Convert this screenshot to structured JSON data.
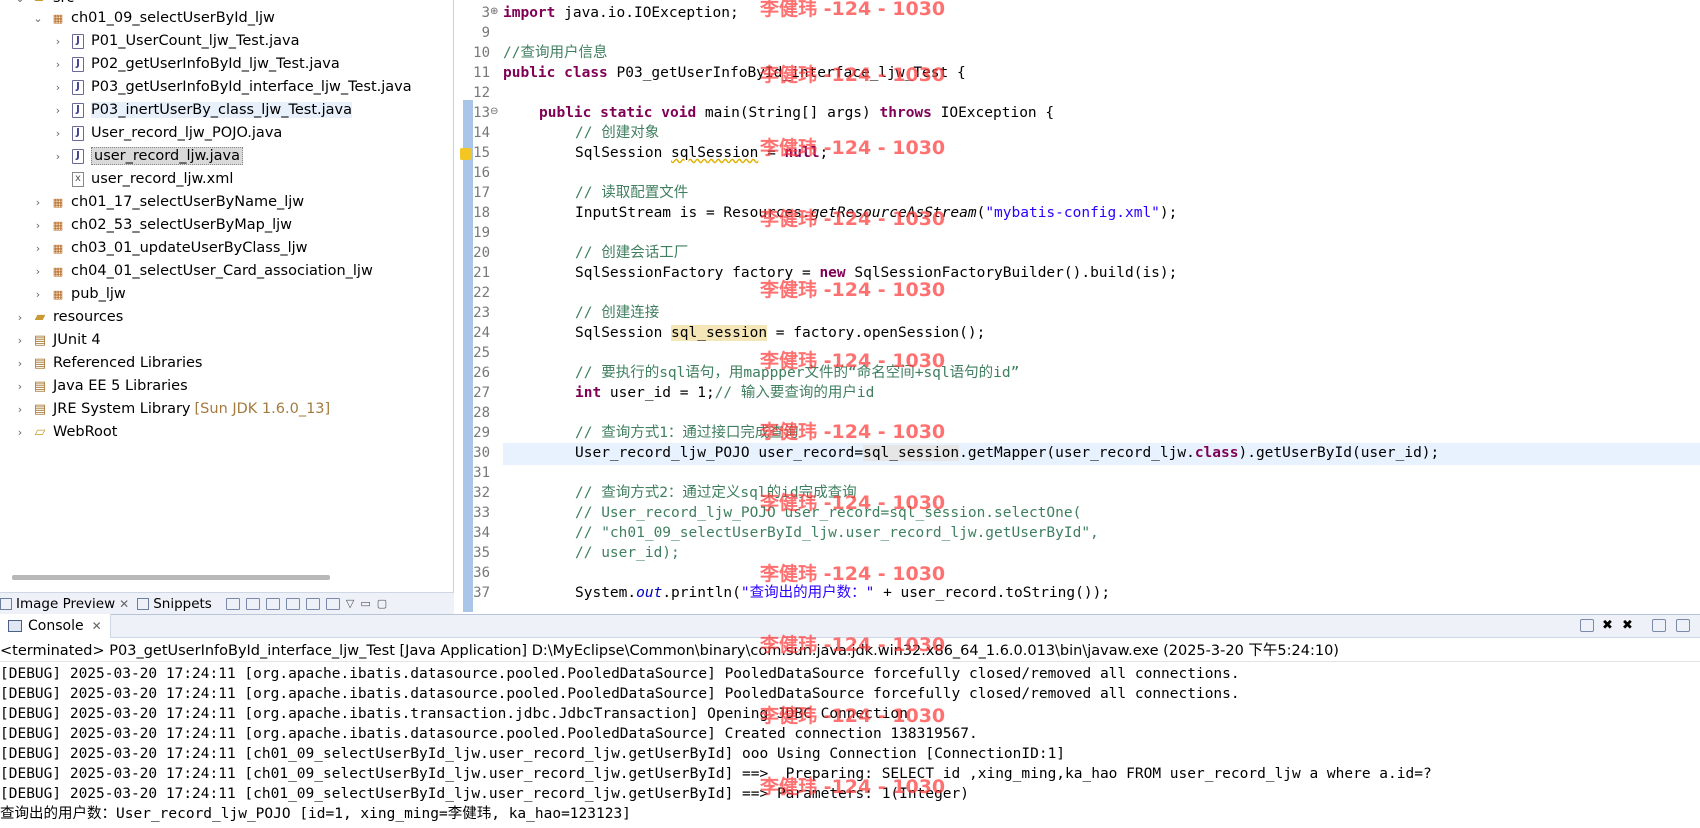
{
  "tree": {
    "items": [
      {
        "label": "src"
      },
      {
        "label": "ch01_09_selectUserById_ljw"
      },
      {
        "label": "P01_UserCount_ljw_Test.java"
      },
      {
        "label": "P02_getUserInfoById_ljw_Test.java"
      },
      {
        "label": "P03_getUserInfoById_interface_ljw_Test.java"
      },
      {
        "label": "P03_inertUserBy_class_ljw_Test.java"
      },
      {
        "label": "User_record_ljw_POJO.java"
      },
      {
        "label": "user_record_ljw.java"
      },
      {
        "label": "user_record_ljw.xml"
      },
      {
        "label": "ch01_17_selectUserByName_ljw"
      },
      {
        "label": "ch02_53_selectUserByMap_ljw"
      },
      {
        "label": "ch03_01_updateUserByClass_ljw"
      },
      {
        "label": "ch04_01_selectUser_Card_association_ljw"
      },
      {
        "label": "pub_ljw"
      },
      {
        "label": "resources"
      },
      {
        "label": "JUnit 4"
      },
      {
        "label": "Referenced Libraries"
      },
      {
        "label": "Java EE 5 Libraries"
      },
      {
        "label": "JRE System Library",
        "extra": "[Sun JDK 1.6.0_13]"
      },
      {
        "label": "WebRoot"
      }
    ]
  },
  "left_tabs": {
    "image_preview": "Image Preview",
    "snippets": "Snippets"
  },
  "editor": {
    "line_numbers": [
      "3",
      "9",
      "10",
      "11",
      "12",
      "13",
      "14",
      "15",
      "16",
      "17",
      "18",
      "19",
      "20",
      "21",
      "22",
      "23",
      "24",
      "25",
      "26",
      "27",
      "28",
      "29",
      "30",
      "31",
      "32",
      "33",
      "34",
      "35",
      "36",
      "37"
    ],
    "l3_kw": "import",
    "l3_rest": " java.io.IOException;",
    "l10": "//查询用户信息",
    "l11_kw1": "public",
    "l11_kw2": "class",
    "l11_rest": " P03_getUserInfoById_interface_ljw_Test {",
    "l13_kw1": "public",
    "l13_kw2": "static",
    "l13_kw3": "void",
    "l13_mid": " main(String[] args) ",
    "l13_kw4": "throws",
    "l13_rest": " IOException {",
    "l14": "// 创建对象",
    "l15_a": "SqlSession ",
    "l15_var": "sqlSession",
    "l15_b": " = ",
    "l15_kw": "null",
    "l15_c": ";",
    "l17": "// 读取配置文件",
    "l18_a": "InputStream is = Resources.",
    "l18_method": "getResourceAsStream",
    "l18_b": "(",
    "l18_str": "\"mybatis-config.xml\"",
    "l18_c": ");",
    "l20": "// 创建会话工厂",
    "l21_a": "SqlSessionFactory factory = ",
    "l21_kw": "new",
    "l21_b": " SqlSessionFactoryBuilder().build(is);",
    "l23": "// 创建连接",
    "l24_a": "SqlSession ",
    "l24_var": "sql_session",
    "l24_b": " = factory.openSession();",
    "l26": "// 要执行的sql语句，用mappper文件的“命名空间+sql语句的id”",
    "l27_kw": "int",
    "l27_a": " user_id = 1;",
    "l27_cm": "// 输入要查询的用户id",
    "l29": "// 查询方式1：通过接口完成查询",
    "l30_a": "User_record_ljw_POJO user_record=",
    "l30_var": "sql_session",
    "l30_b": ".getMapper(user_record_ljw.",
    "l30_kw": "class",
    "l30_c": ").getUserById(user_id);",
    "l32": "// 查询方式2：通过定义sql的id完成查询",
    "l33": "// User_record_ljw_POJO user_record=sql_session.selectOne(",
    "l34": "// \"ch01_09_selectUserById_ljw.user_record_ljw.getUserById\",",
    "l35": "// user_id);",
    "l37_a": "System.",
    "l37_static": "out",
    "l37_b": ".println(",
    "l37_str": "\"查询出的用户数：\"",
    "l37_c": " + user_record.toString());"
  },
  "watermark": "李健玮 -124 - 1030",
  "console": {
    "tab_label": "Console",
    "title": "<terminated> P03_getUserInfoById_interface_ljw_Test [Java Application] D:\\MyEclipse\\Common\\binary\\com.sun.java.jdk.win32.x86_64_1.6.0.013\\bin\\javaw.exe (2025-3-20 下午5:24:10)",
    "lines": [
      "[DEBUG] 2025-03-20 17:24:11 [org.apache.ibatis.datasource.pooled.PooledDataSource] PooledDataSource forcefully closed/removed all connections.",
      "[DEBUG] 2025-03-20 17:24:11 [org.apache.ibatis.datasource.pooled.PooledDataSource] PooledDataSource forcefully closed/removed all connections.",
      "[DEBUG] 2025-03-20 17:24:11 [org.apache.ibatis.transaction.jdbc.JdbcTransaction] Opening JDBC Connection",
      "[DEBUG] 2025-03-20 17:24:11 [org.apache.ibatis.datasource.pooled.PooledDataSource] Created connection 138319567.",
      "[DEBUG] 2025-03-20 17:24:11 [ch01_09_selectUserById_ljw.user_record_ljw.getUserById] ooo Using Connection [ConnectionID:1]",
      "[DEBUG] 2025-03-20 17:24:11 [ch01_09_selectUserById_ljw.user_record_ljw.getUserById] ==>  Preparing: SELECT id ,xing_ming,ka_hao FROM user_record_ljw a where a.id=?",
      "[DEBUG] 2025-03-20 17:24:11 [ch01_09_selectUserById_ljw.user_record_ljw.getUserById] ==> Parameters: 1(Integer)",
      "查询出的用户数：User_record_ljw_POJO [id=1, xing_ming=李健玮, ka_hao=123123]"
    ]
  }
}
